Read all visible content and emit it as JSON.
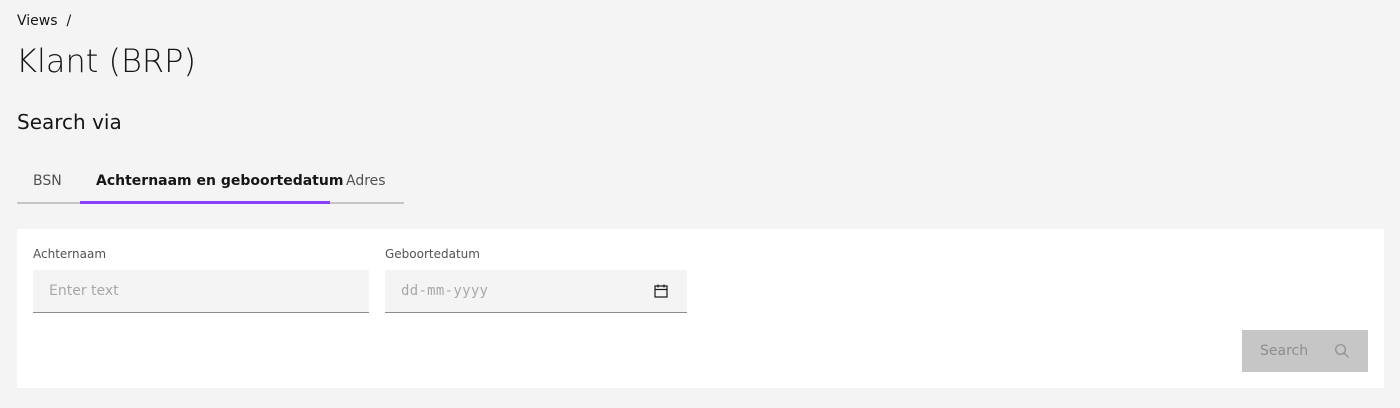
{
  "breadcrumb": {
    "items": [
      "Views"
    ],
    "separator": "/"
  },
  "page": {
    "title": "Klant (BRP)",
    "section_title": "Search via"
  },
  "tabs": [
    {
      "label": "BSN",
      "active": false
    },
    {
      "label": "Achternaam en geboortedatum",
      "active": true
    },
    {
      "label": "Adres",
      "active": false
    }
  ],
  "form": {
    "achternaam": {
      "label": "Achternaam",
      "placeholder": "Enter text",
      "value": ""
    },
    "geboortedatum": {
      "label": "Geboortedatum",
      "placeholder": "dd-mm-yyyy",
      "value": "",
      "icon": "calendar-icon"
    },
    "search_button": {
      "label": "Search",
      "icon": "search-icon",
      "disabled": true
    }
  },
  "colors": {
    "accent": "#8a3ffc",
    "background": "#f4f4f4",
    "panel": "#ffffff",
    "disabled_button": "#c6c6c6"
  }
}
